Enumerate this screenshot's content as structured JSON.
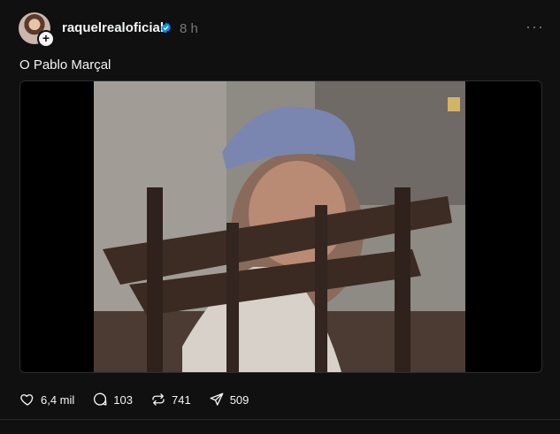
{
  "post": {
    "username": "raquelrealoficial",
    "time": "8 h",
    "caption": "O Pablo Marçal",
    "more_icon": "more-icon",
    "verified_icon": "verified-badge-icon"
  },
  "actions": {
    "likes": "6,4 mil",
    "comments": "103",
    "reposts": "741",
    "shares": "509"
  },
  "colors": {
    "background": "#101010",
    "text": "#f3f5f7",
    "secondary": "#777777",
    "verified": "#0095f6"
  }
}
